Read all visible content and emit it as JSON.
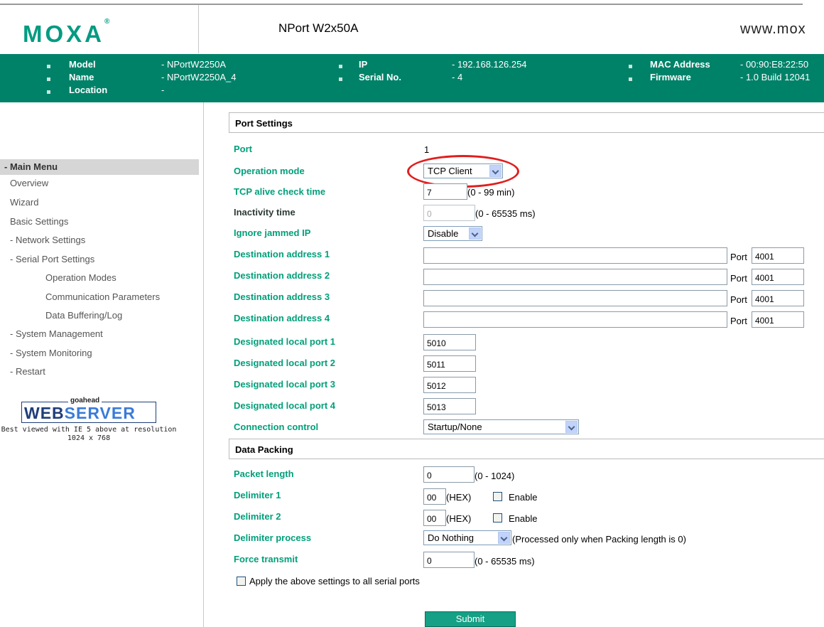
{
  "header": {
    "logo": "MOXA",
    "logo_reg": "®",
    "product": "NPort W2x50A",
    "site": "www.mox"
  },
  "info": {
    "model_label": "Model",
    "model_value": "- NPortW2250A",
    "name_label": "Name",
    "name_value": "- NPortW2250A_4",
    "location_label": "Location",
    "location_value": "-",
    "ip_label": "IP",
    "ip_value": "- 192.168.126.254",
    "serial_label": "Serial No.",
    "serial_value": "- 4",
    "mac_label": "MAC Address",
    "mac_value": "- 00:90:E8:22:50",
    "fw_label": "Firmware",
    "fw_value": "- 1.0 Build 12041"
  },
  "sidebar": {
    "title": "- Main Menu",
    "items": [
      "Overview",
      "Wizard",
      "Basic Settings",
      "- Network Settings",
      "- Serial Port Settings",
      "Operation Modes",
      "Communication Parameters",
      "Data Buffering/Log",
      "- System Management",
      "- System Monitoring",
      "- Restart"
    ],
    "badge_small": "goahead",
    "badge_web": "WEB",
    "badge_server": "SERVER",
    "note": "Best viewed with IE 5 above at resolution 1024 x 768"
  },
  "form": {
    "section_port": "Port Settings",
    "port_label": "Port",
    "port_value": "1",
    "opmode_label": "Operation mode",
    "opmode_value": "TCP Client",
    "tcp_alive_label": "TCP alive check time",
    "tcp_alive_value": "7",
    "tcp_alive_range": "(0 - 99 min)",
    "inactivity_label": "Inactivity time",
    "inactivity_value": "0",
    "inactivity_range": "(0 - 65535 ms)",
    "ignore_ip_label": "Ignore jammed IP",
    "ignore_ip_value": "Disable",
    "port_word": "Port",
    "dest": [
      {
        "label": "Destination address 1",
        "address": "",
        "port": "4001"
      },
      {
        "label": "Destination address 2",
        "address": "",
        "port": "4001"
      },
      {
        "label": "Destination address 3",
        "address": "",
        "port": "4001"
      },
      {
        "label": "Destination address 4",
        "address": "",
        "port": "4001"
      }
    ],
    "local": [
      {
        "label": "Designated local port 1",
        "value": "5010"
      },
      {
        "label": "Designated local port 2",
        "value": "5011"
      },
      {
        "label": "Designated local port 3",
        "value": "5012"
      },
      {
        "label": "Designated local port 4",
        "value": "5013"
      }
    ],
    "conn_label": "Connection control",
    "conn_value": "Startup/None",
    "section_packing": "Data Packing",
    "packet_label": "Packet length",
    "packet_value": "0",
    "packet_range": "(0 - 1024)",
    "delim1_label": "Delimiter 1",
    "delim1_value": "00",
    "delim2_label": "Delimiter 2",
    "delim2_value": "00",
    "hex_word": "(HEX)",
    "enable_word": "Enable",
    "delim_proc_label": "Delimiter process",
    "delim_proc_value": "Do Nothing",
    "delim_proc_note": "(Processed only when Packing length is 0)",
    "force_label": "Force transmit",
    "force_value": "0",
    "force_range": "(0 - 65535 ms)",
    "apply_label": "Apply the above settings to all serial ports",
    "submit": "Submit"
  }
}
